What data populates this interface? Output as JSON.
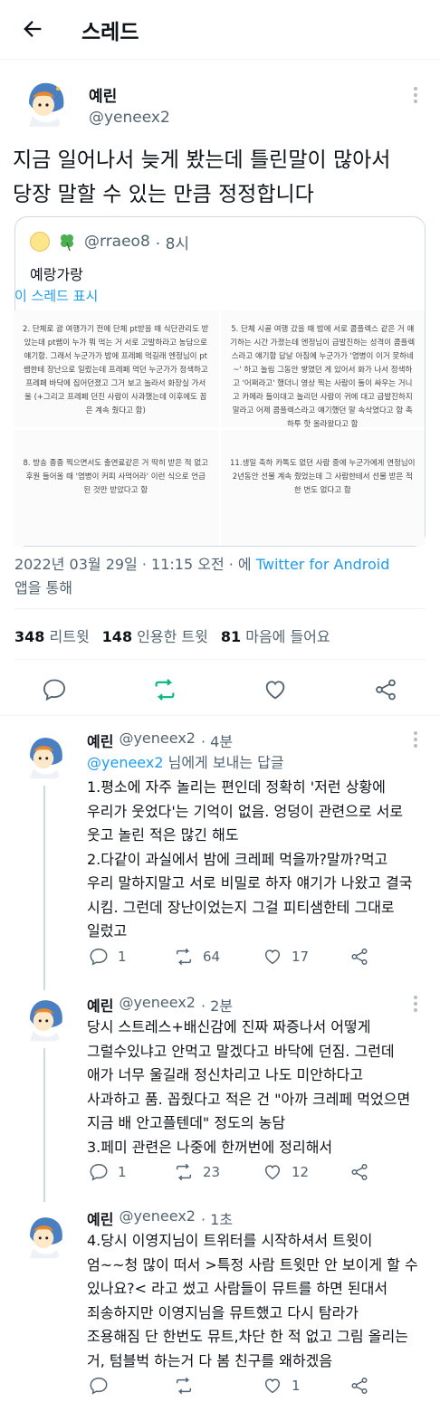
{
  "header": {
    "title": "스레드"
  },
  "tweet": {
    "name": "예린",
    "handle": "@yeneex2",
    "text_line1": "지금 일어나서 늦게 봤는데 틀린말이 많아서",
    "text_line2": "당장 말할 수 있는 만큼 정정합니다",
    "quote": {
      "handle": "@rraeo8",
      "time": "· 8시",
      "text": "예랑가랑",
      "link": "이 스레드 표시",
      "images": [
        "2. 단체로 괌 여행가기 전에 단체 pt받을 때 식단관리도 받았는데 pt쌤이 누가 뭐 먹는 거 서로 고발하라고 농담으로 얘기함. 그래서 누군가가 밤에 프레페 먹길래 엔정님이 pt쌤한테 장난으로 일렀는데 프레페 먹던 누군가가 정색하고 프레페 바닥에 집어던졌고 그거 보고 놀라서 화장실 가서 울 (+그리고 프레페 던진 사람이 사과했는데 이후에도 꼽은 계속 줬다고 함)",
        "5. 단체 시골 여행 갔을 때 밤에 서로 콤플렉스 같은 거 얘기하는 시간 가졌는데 엔정님이 급발진하는 성격이 콤플렉스라고 얘기함 답날 아침에 누군가가 '염병이 이거 못하네~' 하고 놀림 그동안 쌓였던 게 있어서 화가 나서 정색하고 '어쩌라고' 했더니 영상 찍는 사람이 둘이 싸우는 거니고 카메라 들이대고 놀리던 사람이 귀에 대고 급발진하지 말라고 어제 콤플렉스라고 얘기했던 말 속삭였다고 함 촉하투 핫 올라왔다고 함",
        "8. 방송 종종 찍으면서도 출연료같은 거 딱히 받은 적 없고 후원 들어올 때 '염병이 커피 사먹어라' 이런 식으로 언급된 것만 받았다고 함",
        "11.생일 축하 카톡도 없던 사람 중에 누군가에게 연정님이 2년동안 선물 계속 줬었는데 그 사람한테서 선물 받은 적 한 번도 없다고 함"
      ]
    },
    "meta_date": "2022년 03월 29일 · 11:15 오전 · 에 ",
    "meta_source": "Twitter for Android",
    "meta_tail": "앱을 통해",
    "stats": {
      "retweets": "348",
      "retweets_label": "리트윗",
      "quotes": "148",
      "quotes_label": "인용한 트윗",
      "likes": "81",
      "likes_label": "마음에 들어요"
    }
  },
  "replies": [
    {
      "name": "예린",
      "handle": "@yeneex2",
      "time": "· 4분",
      "replying_to": "@yeneex2",
      "replying_suffix": " 님에게 보내는 답글",
      "lines": [
        "1.평소에 자주 놀리는 편인데 정확히 '저런 상황에",
        "우리가 웃었다'는 기억이 없음. 엉덩이 관련으로 서로",
        "웃고 놀린 적은 많긴 해도",
        "2.다같이 과실에서 밤에 크레페 먹을까?말까?먹고",
        "우리 말하지말고 서로 비밀로 하자 얘기가 나왔고 결국",
        "시킴. 그런데 장난이었는지 그걸 피티샘한테 그대로",
        "일렀고"
      ],
      "comments": "1",
      "retweets": "64",
      "likes": "17"
    },
    {
      "name": "예린",
      "handle": "@yeneex2",
      "time": "· 2분",
      "lines": [
        "당시 스트레스+배신감에 진짜 짜증나서 어떻게",
        "그럴수있냐고 안먹고 말겠다고 바닥에 던짐. 그런데",
        "애가 너무 울길래 정신차리고 나도 미안하다고",
        "사과하고 품. 꼽줬다고 적은 건 \"아까 크레페 먹었으면",
        "지금 배 안고플텐데\" 정도의 농담",
        "3.페미 관련은 나중에 한꺼번에 정리해서"
      ],
      "comments": "1",
      "retweets": "23",
      "likes": "12"
    },
    {
      "name": "예린",
      "handle": "@yeneex2",
      "time": "· 1초",
      "lines": [
        "4.당시 이영지님이 트위터를 시작하셔서 트윗이",
        "엄~~청 많이 떠서 >특정 사람 트윗만 안 보이게 할 수",
        "있나요?< 라고 썼고 사람들이 뮤트를 하면 된대서",
        "죄송하지만 이영지님을 뮤트했고 다시 탐라가",
        "조용해짐 단 한번도 뮤트,차단 한 적 없고 그림 올리는",
        "거, 텀블벅 하는거 다 봄 친구를 왜하겠음"
      ],
      "comments": "",
      "retweets": "",
      "likes": "1"
    }
  ],
  "colors": {
    "accent": "#1d9bf0",
    "retweet_green": "#00ba7c",
    "muted": "#536471"
  }
}
